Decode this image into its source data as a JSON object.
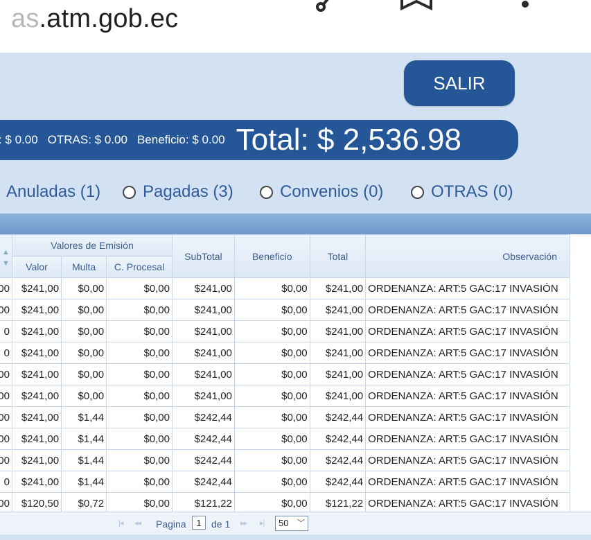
{
  "browser": {
    "url_faded": "as",
    "url_main": ".atm.gob.ec"
  },
  "header": {
    "exit_label": "SALIR",
    "summary_items": [
      "os: $ 0.00",
      "OTRAS: $ 0.00",
      "Beneficio: $ 0.00"
    ],
    "total": "Total: $ 2,536.98"
  },
  "filters": [
    {
      "label": "Anuladas (1)",
      "has_radio": false
    },
    {
      "label": "Pagadas (3)",
      "has_radio": true
    },
    {
      "label": "Convenios (0)",
      "has_radio": true
    },
    {
      "label": "OTRAS (0)",
      "has_radio": true
    }
  ],
  "table": {
    "group_header": "Valores de Emisión",
    "sub_headers": [
      "Valor",
      "Multa",
      "C. Procesal"
    ],
    "headers": {
      "subtotal": "SubTotal",
      "beneficio": "Beneficio",
      "total": "Total",
      "observacion": "Observación"
    },
    "rows": [
      {
        "lead": "00",
        "valor": "$241,00",
        "multa": "$0,00",
        "cprocesal": "$0,00",
        "subtotal": "$241,00",
        "beneficio": "$0,00",
        "total": "$241,00",
        "obs": "ORDENANZA:  ART:5 GAC:17 INVASIÓN"
      },
      {
        "lead": "00",
        "valor": "$241,00",
        "multa": "$0,00",
        "cprocesal": "$0,00",
        "subtotal": "$241,00",
        "beneficio": "$0,00",
        "total": "$241,00",
        "obs": "ORDENANZA:  ART:5 GAC:17 INVASIÓN"
      },
      {
        "lead": "0",
        "valor": "$241,00",
        "multa": "$0,00",
        "cprocesal": "$0,00",
        "subtotal": "$241,00",
        "beneficio": "$0,00",
        "total": "$241,00",
        "obs": "ORDENANZA:  ART:5 GAC:17 INVASIÓN"
      },
      {
        "lead": "0",
        "valor": "$241,00",
        "multa": "$0,00",
        "cprocesal": "$0,00",
        "subtotal": "$241,00",
        "beneficio": "$0,00",
        "total": "$241,00",
        "obs": "ORDENANZA:  ART:5 GAC:17 INVASIÓN"
      },
      {
        "lead": "00",
        "valor": "$241,00",
        "multa": "$0,00",
        "cprocesal": "$0,00",
        "subtotal": "$241,00",
        "beneficio": "$0,00",
        "total": "$241,00",
        "obs": "ORDENANZA:  ART:5 GAC:17 INVASIÓN"
      },
      {
        "lead": "00",
        "valor": "$241,00",
        "multa": "$0,00",
        "cprocesal": "$0,00",
        "subtotal": "$241,00",
        "beneficio": "$0,00",
        "total": "$241,00",
        "obs": "ORDENANZA:  ART:5 GAC:17 INVASIÓN"
      },
      {
        "lead": "00",
        "valor": "$241,00",
        "multa": "$1,44",
        "cprocesal": "$0,00",
        "subtotal": "$242,44",
        "beneficio": "$0,00",
        "total": "$242,44",
        "obs": "ORDENANZA:  ART:5 GAC:17 INVASIÓN"
      },
      {
        "lead": "00",
        "valor": "$241,00",
        "multa": "$1,44",
        "cprocesal": "$0,00",
        "subtotal": "$242,44",
        "beneficio": "$0,00",
        "total": "$242,44",
        "obs": "ORDENANZA:  ART:5 GAC:17 INVASIÓN"
      },
      {
        "lead": "00",
        "valor": "$241,00",
        "multa": "$1,44",
        "cprocesal": "$0,00",
        "subtotal": "$242,44",
        "beneficio": "$0,00",
        "total": "$242,44",
        "obs": "ORDENANZA:  ART:5 GAC:17 INVASIÓN"
      },
      {
        "lead": "0",
        "valor": "$241,00",
        "multa": "$1,44",
        "cprocesal": "$0,00",
        "subtotal": "$242,44",
        "beneficio": "$0,00",
        "total": "$242,44",
        "obs": "ORDENANZA:  ART:5 GAC:17 INVASIÓN"
      },
      {
        "lead": "00",
        "valor": "$120,50",
        "multa": "$0,72",
        "cprocesal": "$0,00",
        "subtotal": "$121,22",
        "beneficio": "$0,00",
        "total": "$121,22",
        "obs": "ORDENANZA:  ART:5 GAC:17 INVASIÓN"
      }
    ]
  },
  "pager": {
    "page_label": "Pagina",
    "page_value": "1",
    "of_label": "de 1",
    "page_size": "50"
  },
  "colors": {
    "primary": "#245698",
    "background": "#d3e2f3",
    "filter_text": "#2f5c98"
  }
}
